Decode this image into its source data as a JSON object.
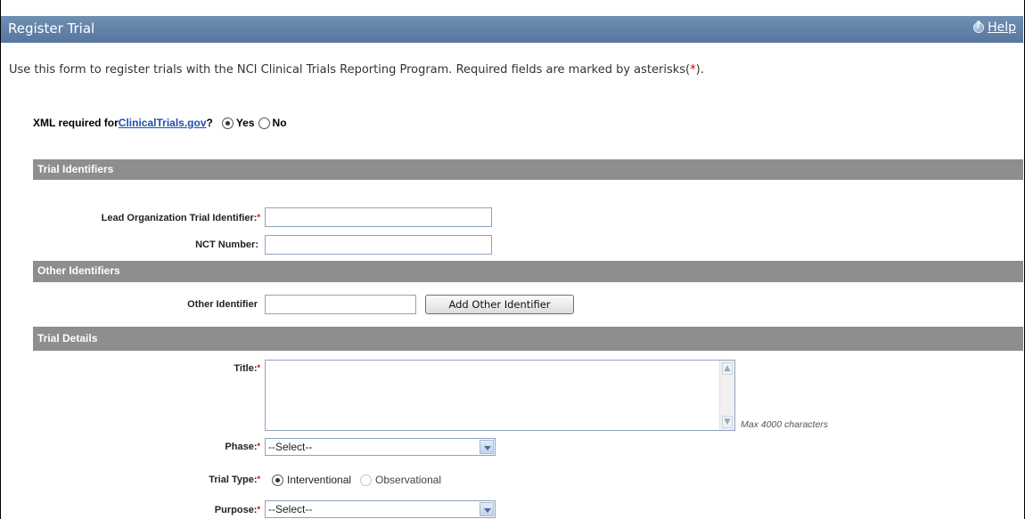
{
  "header": {
    "title": "Register Trial",
    "help_label": "Help"
  },
  "intro": {
    "text": "Use this form to register trials with the NCI Clinical Trials Reporting Program. Required fields are marked by asterisks(",
    "star": "*",
    "close": ")."
  },
  "xml": {
    "label_prefix": "XML required for ",
    "link_text": "ClinicalTrials.gov",
    "label_suffix": "?",
    "options": [
      "Yes",
      "No"
    ],
    "selected": "Yes"
  },
  "sections": {
    "trial_identifiers": "Trial Identifiers",
    "other_identifiers": "Other Identifiers",
    "trial_details": "Trial Details"
  },
  "fields": {
    "lead_org_label": "Lead Organization Trial Identifier:",
    "lead_org_value": "",
    "nct_label": "NCT Number:",
    "nct_value": "",
    "other_identifier_label": "Other Identifier",
    "other_identifier_value": "",
    "add_other_identifier_button": "Add Other Identifier",
    "title_label": "Title:",
    "title_hint": "Max 4000 characters",
    "phase_label": "Phase:",
    "phase_selected": "--Select--",
    "trial_type_label": "Trial Type:",
    "trial_type_options": [
      "Interventional",
      "Observational"
    ],
    "trial_type_selected": "Interventional",
    "purpose_label": "Purpose:",
    "purpose_selected": "--Select--",
    "required_marker": "*"
  },
  "colors": {
    "title_bar": "#6384ad",
    "section_bar": "#8e8e8e",
    "required": "#d00000",
    "link": "#1c4fb0"
  }
}
